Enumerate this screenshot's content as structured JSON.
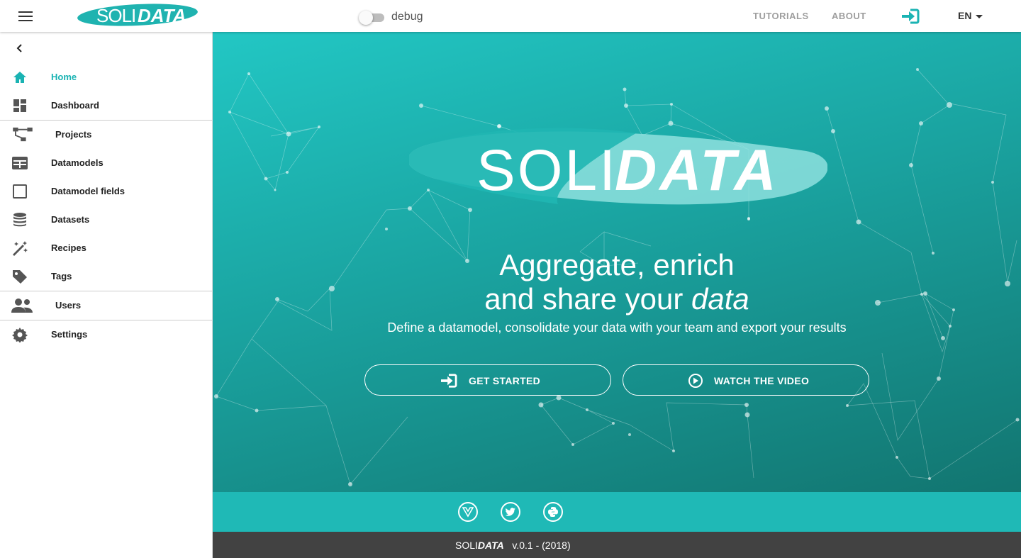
{
  "header": {
    "logo_text_light": "SOLI",
    "logo_text_bold": "DATA",
    "debug_label": "debug",
    "nav_tutorials": "TUTORIALS",
    "nav_about": "ABOUT",
    "language": "EN",
    "accent_color": "#1ab3b3"
  },
  "sidebar": {
    "items": [
      {
        "label": "Home",
        "icon": "home-icon",
        "active": true
      },
      {
        "label": "Dashboard",
        "icon": "dashboard-icon"
      },
      {
        "label": "Projects",
        "icon": "project-tree-icon"
      },
      {
        "label": "Datamodels",
        "icon": "table-icon"
      },
      {
        "label": "Datamodel fields",
        "icon": "square-outline-icon"
      },
      {
        "label": "Datasets",
        "icon": "database-icon"
      },
      {
        "label": "Recipes",
        "icon": "magic-wand-icon"
      },
      {
        "label": "Tags",
        "icon": "tag-icon"
      },
      {
        "label": "Users",
        "icon": "users-icon"
      },
      {
        "label": "Settings",
        "icon": "gear-icon"
      }
    ]
  },
  "hero": {
    "logo_light": "SOLI",
    "logo_bold": "DATA",
    "headline_line1": "Aggregate, enrich",
    "headline_line2_prefix": "and share your ",
    "headline_line2_em": "data",
    "subtitle": "Define a datamodel, consolidate your data with your team and export your results",
    "cta_primary": "GET STARTED",
    "cta_secondary": "WATCH THE VIDEO"
  },
  "footer": {
    "social_icons": [
      "vue-icon",
      "twitter-icon",
      "python-icon"
    ],
    "brand_light": "SOLI",
    "brand_bold": "DATA",
    "version": "v.0.1 - (2018)"
  }
}
